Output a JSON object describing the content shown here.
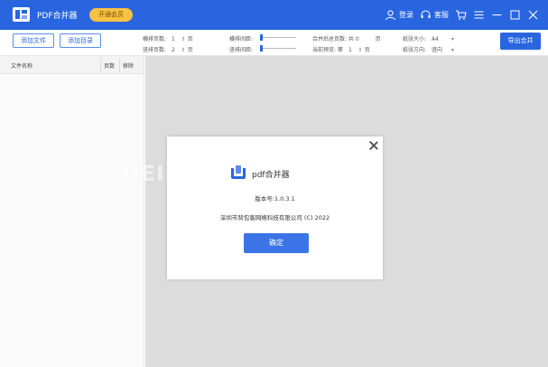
{
  "titlebar": {
    "app_title": "PDF合并器",
    "vip_label": "开通会员",
    "login_label": "登录",
    "service_label": "客服",
    "color": "#2a65e0"
  },
  "toolbar": {
    "add_file_label": "添加文件",
    "add_dir_label": "添加目录",
    "h_pages_label": "横排页数:",
    "h_pages_value": "1",
    "v_pages_label": "竖排页数:",
    "v_pages_value": "2",
    "page_unit": "页",
    "h_spacing_label": "横排间距:",
    "v_spacing_label": "竖排间距:",
    "total_pages_label": "合并后总页数: 共 0",
    "preview_label": "当前预览: 第",
    "preview_value": "1",
    "paper_size_label": "纸张大小:",
    "paper_size_value": "A4",
    "paper_dir_label": "纸张方向:",
    "paper_dir_value": "竖向",
    "export_label": "导出合并"
  },
  "file_list": {
    "col_name": "文件名称",
    "col_pages": "页数",
    "col_remove": "移除"
  },
  "dialog": {
    "app_name": "pdf合并器",
    "version": "版本号:1.0.3.1",
    "copyright": "深圳市背包客网络科技有限公司 (C) 2022",
    "ok_label": "确定"
  },
  "watermark": "UEI"
}
